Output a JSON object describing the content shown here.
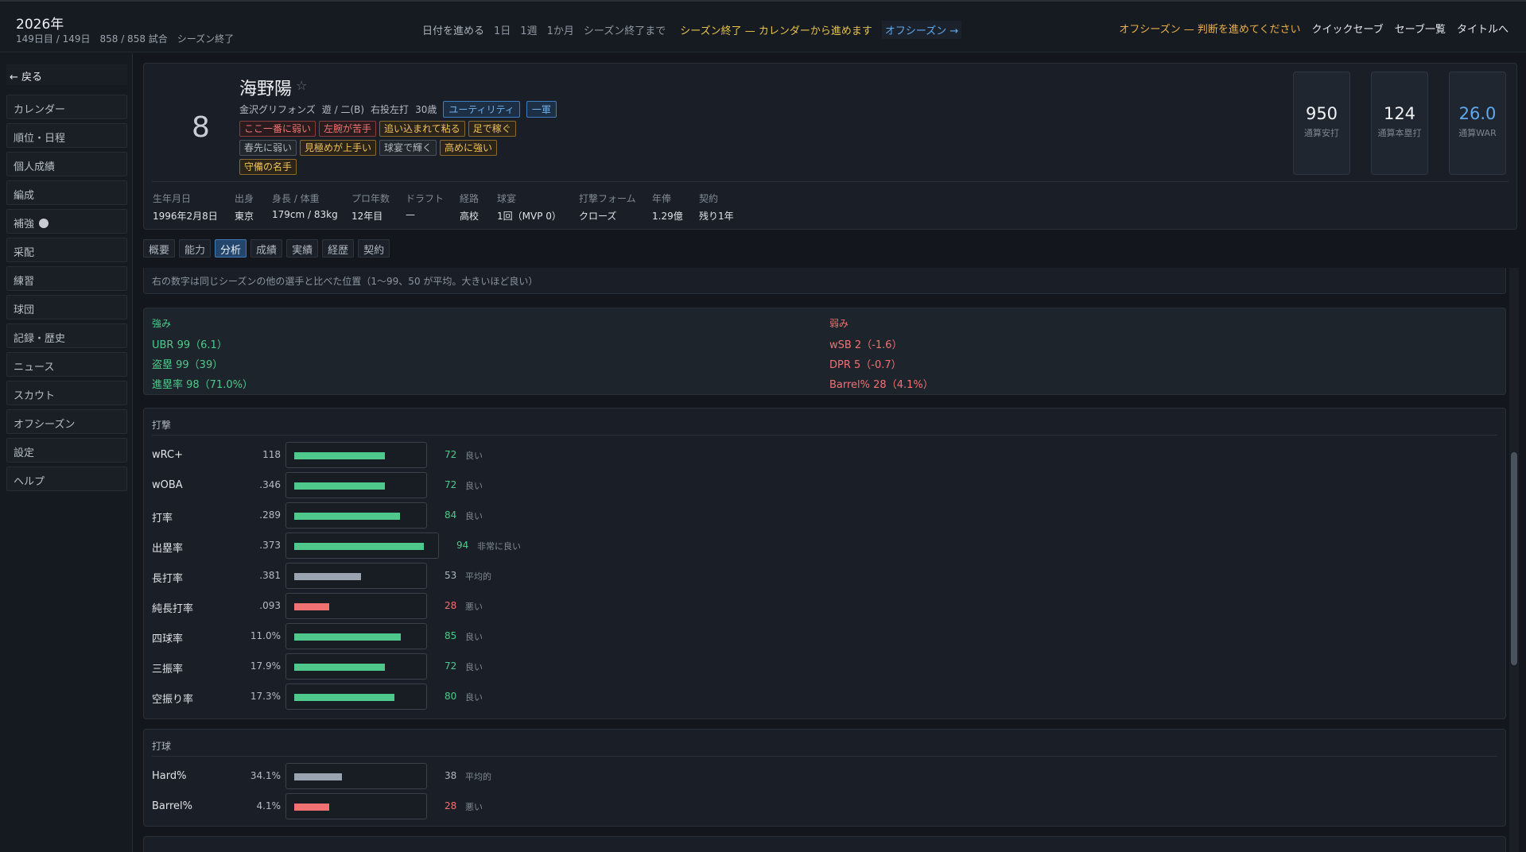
{
  "header": {
    "year": "2026年",
    "season_info": "149日目 / 149日　858 / 858 試合　シーズン終了",
    "advance_label": "日付を進める",
    "advance_options": [
      "1日",
      "1週",
      "1か月",
      "シーズン終了まで"
    ],
    "season_end_message": "シーズン終了 — カレンダーから進めます",
    "offseason_link": "オフシーズン →",
    "notice": "オフシーズン — 判断を進めてください",
    "actions": [
      "クイックセーブ",
      "セーブ一覧",
      "タイトルへ"
    ]
  },
  "sidebar": {
    "back": "← 戻る",
    "items": [
      "カレンダー",
      "順位・日程",
      "個人成績",
      "編成",
      "補強",
      "采配",
      "練習",
      "球団",
      "記録・歴史",
      "ニュース",
      "スカウト",
      "オフシーズン",
      "設定",
      "ヘルプ"
    ]
  },
  "player": {
    "number": "8",
    "name": "海野陽",
    "star": "☆",
    "team": "金沢グリフォンズ",
    "position": "遊 / 二(B)",
    "bats_throws": "右投左打",
    "age": "30歳",
    "role_badge": "ユーティリティ",
    "squad_badge": "一軍",
    "traits": [
      {
        "label": "ここ一番に弱い",
        "kind": "neg"
      },
      {
        "label": "左腕が苦手",
        "kind": "neg"
      },
      {
        "label": "追い込まれて粘る",
        "kind": "pos"
      },
      {
        "label": "足で稼ぐ",
        "kind": "pos"
      },
      {
        "label": "春先に弱い",
        "kind": "neu"
      },
      {
        "label": "見極めが上手い",
        "kind": "pos"
      },
      {
        "label": "球宴で輝く",
        "kind": "neu"
      },
      {
        "label": "高めに強い",
        "kind": "pos"
      },
      {
        "label": "守備の名手",
        "kind": "pos"
      }
    ],
    "career": [
      {
        "value": "950",
        "label": "通算安打"
      },
      {
        "value": "124",
        "label": "通算本塁打"
      },
      {
        "value": "26.0",
        "label": "通算WAR"
      }
    ],
    "bio": [
      {
        "label": "生年月日",
        "value": "1996年2月8日"
      },
      {
        "label": "出身",
        "value": "東京"
      },
      {
        "label": "身長 / 体重",
        "value": "179cm / 83kg"
      },
      {
        "label": "プロ年数",
        "value": "12年目"
      },
      {
        "label": "ドラフト",
        "value": "—"
      },
      {
        "label": "経路",
        "value": "高校"
      },
      {
        "label": "球宴",
        "value": "1回（MVP 0）"
      },
      {
        "label": "打撃フォーム",
        "value": "クローズ"
      },
      {
        "label": "年俸",
        "value": "1.29億"
      },
      {
        "label": "契約",
        "value": "残り1年"
      }
    ]
  },
  "tabs": [
    "概要",
    "能力",
    "分析",
    "成績",
    "実績",
    "経歴",
    "契約"
  ],
  "active_tab": "分析",
  "analysis": {
    "note": "右の数字は同じシーズンの他の選手と比べた位置（1〜99、50 が平均。大きいほど良い）",
    "strengths_title": "強み",
    "strengths": [
      "UBR 99（6.1）",
      "盗塁 99（39）",
      "進塁率 98（71.0%）"
    ],
    "weaknesses_title": "弱み",
    "weaknesses": [
      "wSB 2（-1.6）",
      "DPR 5（-0.7）",
      "Barrel% 28（4.1%）"
    ],
    "batting": {
      "title": "打撃",
      "rows": [
        {
          "name": "wRC+",
          "value": "118",
          "pct": 72,
          "grade": "良い",
          "kind": "good"
        },
        {
          "name": "wOBA",
          "value": ".346",
          "pct": 72,
          "grade": "良い",
          "kind": "good"
        },
        {
          "name": "打率",
          "value": ".289",
          "pct": 84,
          "grade": "良い",
          "kind": "good"
        },
        {
          "name": "出塁率",
          "value": ".373",
          "pct": 94,
          "grade": "非常に良い",
          "kind": "good"
        },
        {
          "name": "長打率",
          "value": ".381",
          "pct": 53,
          "grade": "平均的",
          "kind": "avg"
        },
        {
          "name": "純長打率",
          "value": ".093",
          "pct": 28,
          "grade": "悪い",
          "kind": "bad"
        },
        {
          "name": "四球率",
          "value": "11.0%",
          "pct": 85,
          "grade": "良い",
          "kind": "good"
        },
        {
          "name": "三振率",
          "value": "17.9%",
          "pct": 72,
          "grade": "良い",
          "kind": "good"
        },
        {
          "name": "空振り率",
          "value": "17.3%",
          "pct": 80,
          "grade": "良い",
          "kind": "good"
        }
      ]
    },
    "batted_ball": {
      "title": "打球",
      "rows": [
        {
          "name": "Hard%",
          "value": "34.1%",
          "pct": 38,
          "grade": "平均的",
          "kind": "avg"
        },
        {
          "name": "Barrel%",
          "value": "4.1%",
          "pct": 28,
          "grade": "悪い",
          "kind": "bad"
        }
      ]
    }
  },
  "colors": {
    "good": "#4fc98b",
    "avg": "#9aa3b0",
    "bad": "#f07171",
    "accent": "#5ea9f0"
  }
}
